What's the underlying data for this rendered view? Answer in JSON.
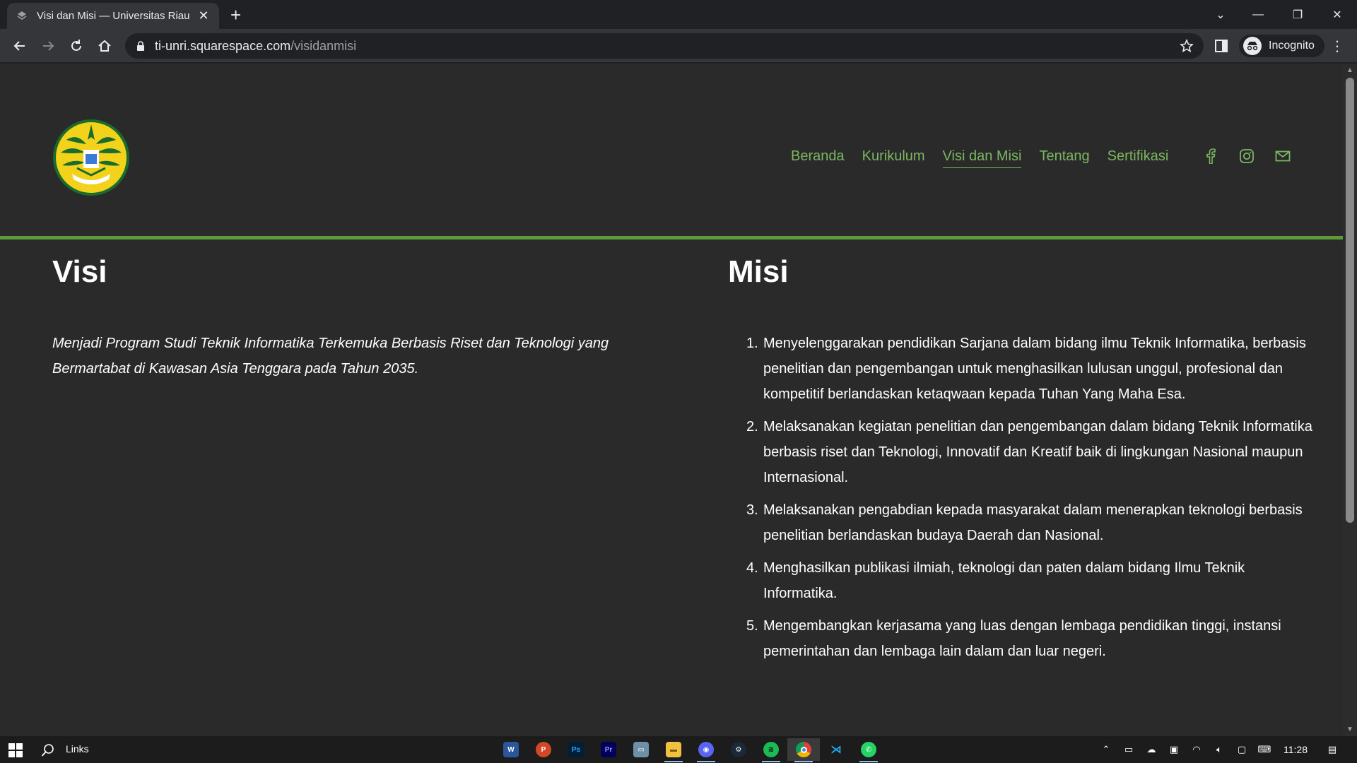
{
  "browser": {
    "tab_title": "Visi dan Misi — Universitas Riau",
    "url_host": "ti-unri.squarespace.com",
    "url_path": "/visidanmisi",
    "profile_label": "Incognito"
  },
  "site": {
    "nav": [
      {
        "label": "Beranda"
      },
      {
        "label": "Kurikulum"
      },
      {
        "label": "Visi dan Misi"
      },
      {
        "label": "Tentang"
      },
      {
        "label": "Sertifikasi"
      }
    ],
    "active_nav": "Visi dan Misi",
    "social": [
      "facebook-icon",
      "instagram-icon",
      "email-icon"
    ],
    "accent_color": "#7bb661",
    "divider_color": "#5a9a3a"
  },
  "visi": {
    "heading": "Visi",
    "text": "Menjadi Program Studi Teknik Informatika Terkemuka Berbasis Riset dan Teknologi yang Bermartabat di Kawasan Asia Tenggara pada Tahun 2035."
  },
  "misi": {
    "heading": "Misi",
    "items": [
      {
        "num": "1.",
        "text": "Menyelenggarakan pendidikan Sarjana dalam bidang ilmu Teknik Informatika, berbasis penelitian dan pengembangan untuk menghasilkan lulusan unggul, profesional dan kompetitif berlandaskan ketaqwaan kepada Tuhan Yang Maha Esa."
      },
      {
        "num": "2.",
        "text": "Melaksanakan kegiatan penelitian dan pengembangan dalam bidang Teknik Informatika berbasis riset  dan Teknologi, Innovatif dan Kreatif baik di lingkungan Nasional maupun Internasional."
      },
      {
        "num": "3.",
        "text": "Melaksanakan pengabdian kepada masyarakat dalam menerapkan teknologi berbasis penelitian berlandaskan budaya Daerah dan Nasional."
      },
      {
        "num": "4.",
        "text": "Menghasilkan publikasi ilmiah, teknologi dan paten dalam bidang Ilmu Teknik Informatika."
      },
      {
        "num": "5.",
        "text": "Mengembangkan kerjasama yang luas dengan lembaga pendidikan tinggi, instansi pemerintahan dan lembaga lain dalam dan luar negeri."
      }
    ]
  },
  "taskbar": {
    "search_label": "Links",
    "clock": "11:28",
    "apps": [
      "word-icon",
      "powerpoint-icon",
      "photoshop-icon",
      "premiere-icon",
      "remote-desktop-icon",
      "file-explorer-icon",
      "discord-icon",
      "steam-icon",
      "spotify-icon",
      "chrome-icon",
      "vscode-icon",
      "whatsapp-icon"
    ]
  }
}
